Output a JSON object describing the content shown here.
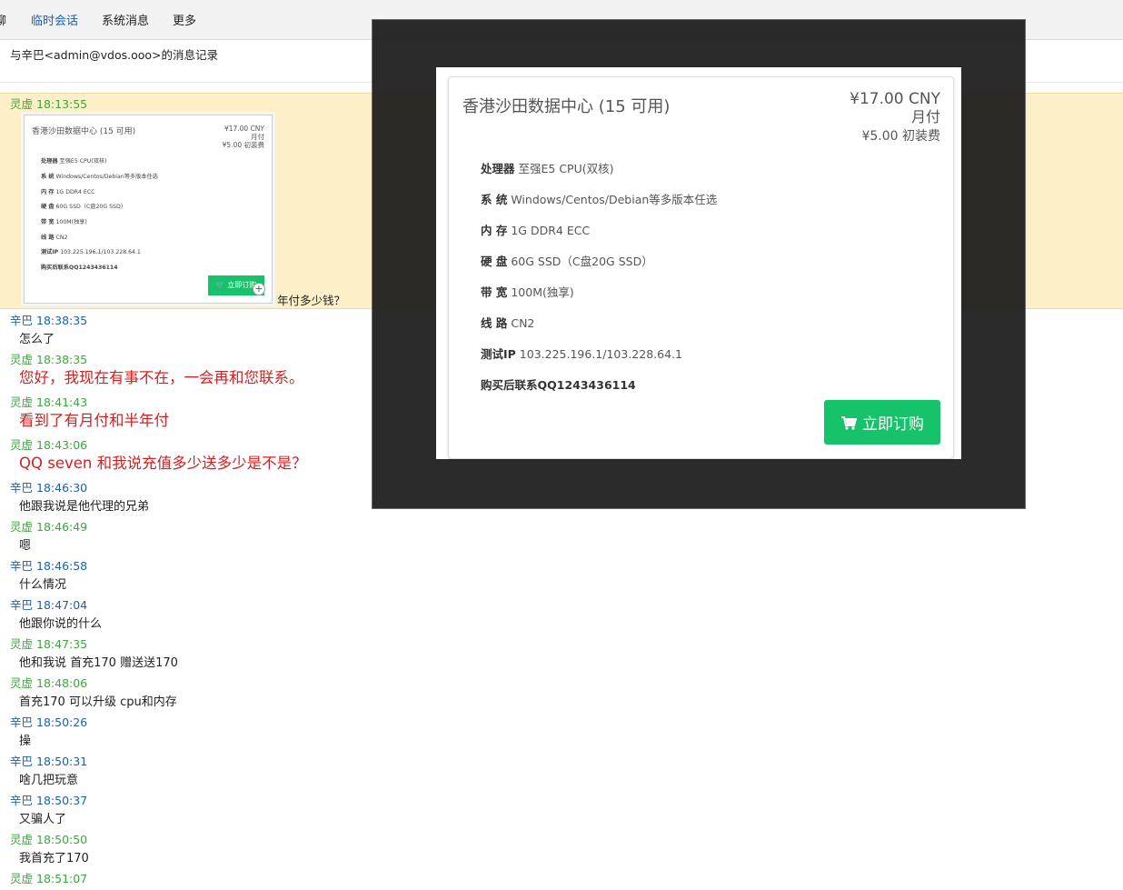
{
  "tabs": [
    {
      "label": "聊",
      "active": false
    },
    {
      "label": "临时会话",
      "active": true
    },
    {
      "label": "系统消息",
      "active": false
    },
    {
      "label": "更多",
      "active": false
    }
  ],
  "log_title": "与辛巴<admin@vdos.ooo>的消息记录",
  "highlighted": {
    "sender": "灵虚",
    "time": "18:13:55",
    "text": "年付多少钱？"
  },
  "product": {
    "title": "香港沙田数据中心 (15 可用)",
    "price": "¥17.00 CNY",
    "period": "月付",
    "setup_fee": "¥5.00 初装费",
    "specs": [
      {
        "label": "处理器",
        "value": "至强E5 CPU(双核)"
      },
      {
        "label": "系 统",
        "value": "Windows/Centos/Debian等多版本任选"
      },
      {
        "label": "内 存",
        "value": "1G DDR4 ECC"
      },
      {
        "label": "硬 盘",
        "value": "60G SSD（C盘20G SSD）"
      },
      {
        "label": "带 宽",
        "value": "100M(独享)"
      },
      {
        "label": "线 路",
        "value": "CN2"
      },
      {
        "label": "测试IP",
        "value": "103.225.196.1/103.228.64.1"
      },
      {
        "label": "购买后联系QQ1243436114",
        "value": ""
      }
    ],
    "buy_label": "立即订购"
  },
  "messages": [
    {
      "sender": "辛巴",
      "time": "18:38:35",
      "text": "怎么了",
      "big": false
    },
    {
      "sender": "灵虚",
      "time": "18:38:35",
      "text": "您好，我现在有事不在，一会再和您联系。",
      "big": true
    },
    {
      "sender": "灵虚",
      "time": "18:41:43",
      "text": "看到了有月付和半年付",
      "big": true
    },
    {
      "sender": "灵虚",
      "time": "18:43:06",
      "text": "QQ seven 和我说充值多少送多少是不是？",
      "big": true
    },
    {
      "sender": "辛巴",
      "time": "18:46:30",
      "text": "他跟我说是他代理的兄弟",
      "big": false
    },
    {
      "sender": "灵虚",
      "time": "18:46:49",
      "text": "嗯",
      "big": false
    },
    {
      "sender": "辛巴",
      "time": "18:46:58",
      "text": "什么情况",
      "big": false
    },
    {
      "sender": "辛巴",
      "time": "18:47:04",
      "text": "他跟你说的什么",
      "big": false
    },
    {
      "sender": "灵虚",
      "time": "18:47:35",
      "text": "他和我说 首充170 赠送送170",
      "big": false
    },
    {
      "sender": "灵虚",
      "time": "18:48:06",
      "text": "首充170 可以升级 cpu和内存",
      "big": false
    },
    {
      "sender": "辛巴",
      "time": "18:50:26",
      "text": "操",
      "big": false
    },
    {
      "sender": "辛巴",
      "time": "18:50:31",
      "text": "啥几把玩意",
      "big": false
    },
    {
      "sender": "辛巴",
      "time": "18:50:37",
      "text": "又骗人了",
      "big": false
    },
    {
      "sender": "灵虚",
      "time": "18:50:50",
      "text": "我首充了170",
      "big": false
    },
    {
      "sender": "灵虚",
      "time": "18:51:07",
      "text": "",
      "big": false
    }
  ],
  "colors": {
    "self": "#3aa83a",
    "other": "#1a5fb4",
    "auto_reply": "#d42020",
    "buy_button": "#17c36a",
    "highlight_bg": "#fdefc7"
  }
}
